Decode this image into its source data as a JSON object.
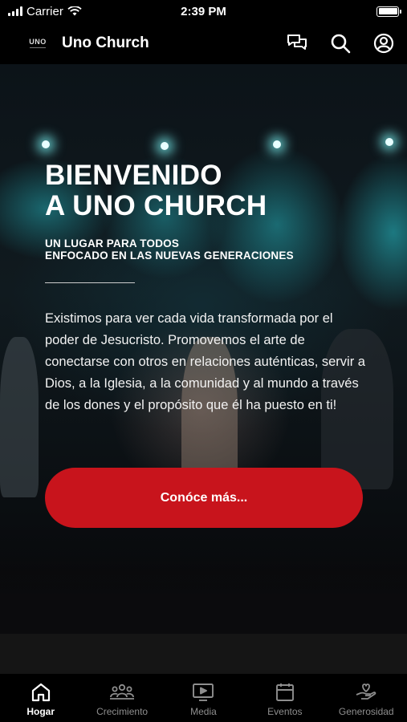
{
  "status_bar": {
    "carrier": "Carrier",
    "time": "2:39 PM",
    "battery_level": 1.0
  },
  "header": {
    "logo_text": "UNO",
    "title": "Uno Church",
    "icons": [
      "chat-icon",
      "search-icon",
      "profile-icon"
    ]
  },
  "hero": {
    "title_line1": "BIENVENIDO",
    "title_line2": "A UNO CHURCH",
    "subtitle_line1": "UN LUGAR PARA TODOS",
    "subtitle_line2": "ENFOCADO EN LAS NUEVAS GENERACIONES",
    "body": "Existimos para ver cada vida transformada por el poder de Jesucristo. Promovemos el arte de  conectarse con otros en relaciones auténticas, servir a Dios, a la Iglesia, a la comunidad y al mundo a través de los dones y el propósito que él ha puesto en ti!",
    "cta_label": "Conóce más...",
    "cta_color": "#c8141c"
  },
  "tabs": [
    {
      "label": "Hogar",
      "icon": "home-icon",
      "active": true
    },
    {
      "label": "Crecimiento",
      "icon": "group-icon",
      "active": false
    },
    {
      "label": "Media",
      "icon": "tv-icon",
      "active": false
    },
    {
      "label": "Eventos",
      "icon": "calendar-icon",
      "active": false
    },
    {
      "label": "Generosidad",
      "icon": "hand-heart-icon",
      "active": false
    }
  ]
}
